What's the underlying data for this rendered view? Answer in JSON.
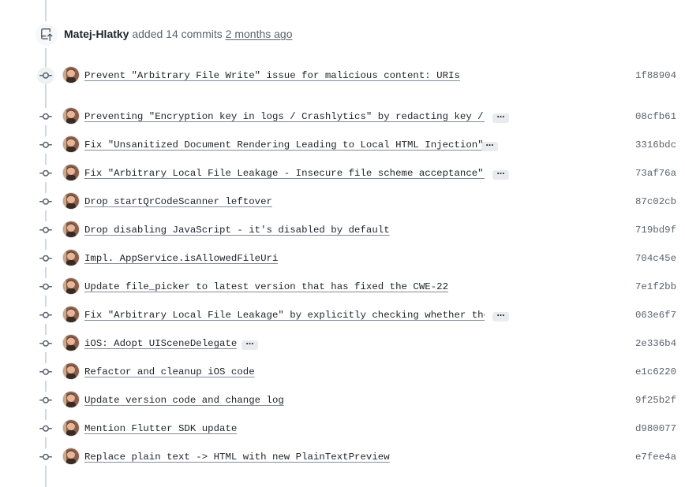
{
  "header": {
    "author": "Matej-Hlatky",
    "action_text": "added 14 commits",
    "time": "2 months ago",
    "icon": "repo-push-icon"
  },
  "colors": {
    "timeline": "#d1d9e0",
    "text": "#1f2328",
    "muted": "#59636e",
    "ellipsis_bg": "#e8ebef"
  },
  "commits": [
    {
      "message": "Prevent \"Arbitrary File Write\" issue for malicious content: URIs",
      "sha": "1f88904",
      "has_ellipsis": false
    },
    {
      "message": "Preventing \"Encryption key in logs / Crashlytics\" by redacting key / …",
      "sha": "08cfb61",
      "has_ellipsis": true
    },
    {
      "message": "Fix \"Unsanitized Document Rendering Leading to Local HTML Injection\"",
      "sha": "3316bdc",
      "has_ellipsis": true
    },
    {
      "message": "Fix \"Arbitrary Local File Leakage - Insecure file scheme acceptance\" …",
      "sha": "73af76a",
      "has_ellipsis": true
    },
    {
      "message": "Drop startQrCodeScanner leftover",
      "sha": "87c02cb",
      "has_ellipsis": false
    },
    {
      "message": "Drop disabling JavaScript - it's disabled by default",
      "sha": "719bd9f",
      "has_ellipsis": false
    },
    {
      "message": "Impl. AppService.isAllowedFileUri",
      "sha": "704c45e",
      "has_ellipsis": false
    },
    {
      "message": "Update file_picker to latest version that has fixed the CWE-22",
      "sha": "7e1f2bb",
      "has_ellipsis": false
    },
    {
      "message": "Fix \"Arbitrary Local File Leakage\" by explicitly checking whether the…",
      "sha": "063e6f7",
      "has_ellipsis": true
    },
    {
      "message": "iOS: Adopt UISceneDelegate",
      "sha": "2e336b4",
      "has_ellipsis": true
    },
    {
      "message": "Refactor and cleanup iOS code",
      "sha": "e1c6220",
      "has_ellipsis": false
    },
    {
      "message": "Update version code and change log",
      "sha": "9f25b2f",
      "has_ellipsis": false
    },
    {
      "message": "Mention Flutter SDK update",
      "sha": "d980077",
      "has_ellipsis": false
    },
    {
      "message": "Replace plain text -> HTML with new PlainTextPreview",
      "sha": "e7fee4a",
      "has_ellipsis": false
    }
  ]
}
